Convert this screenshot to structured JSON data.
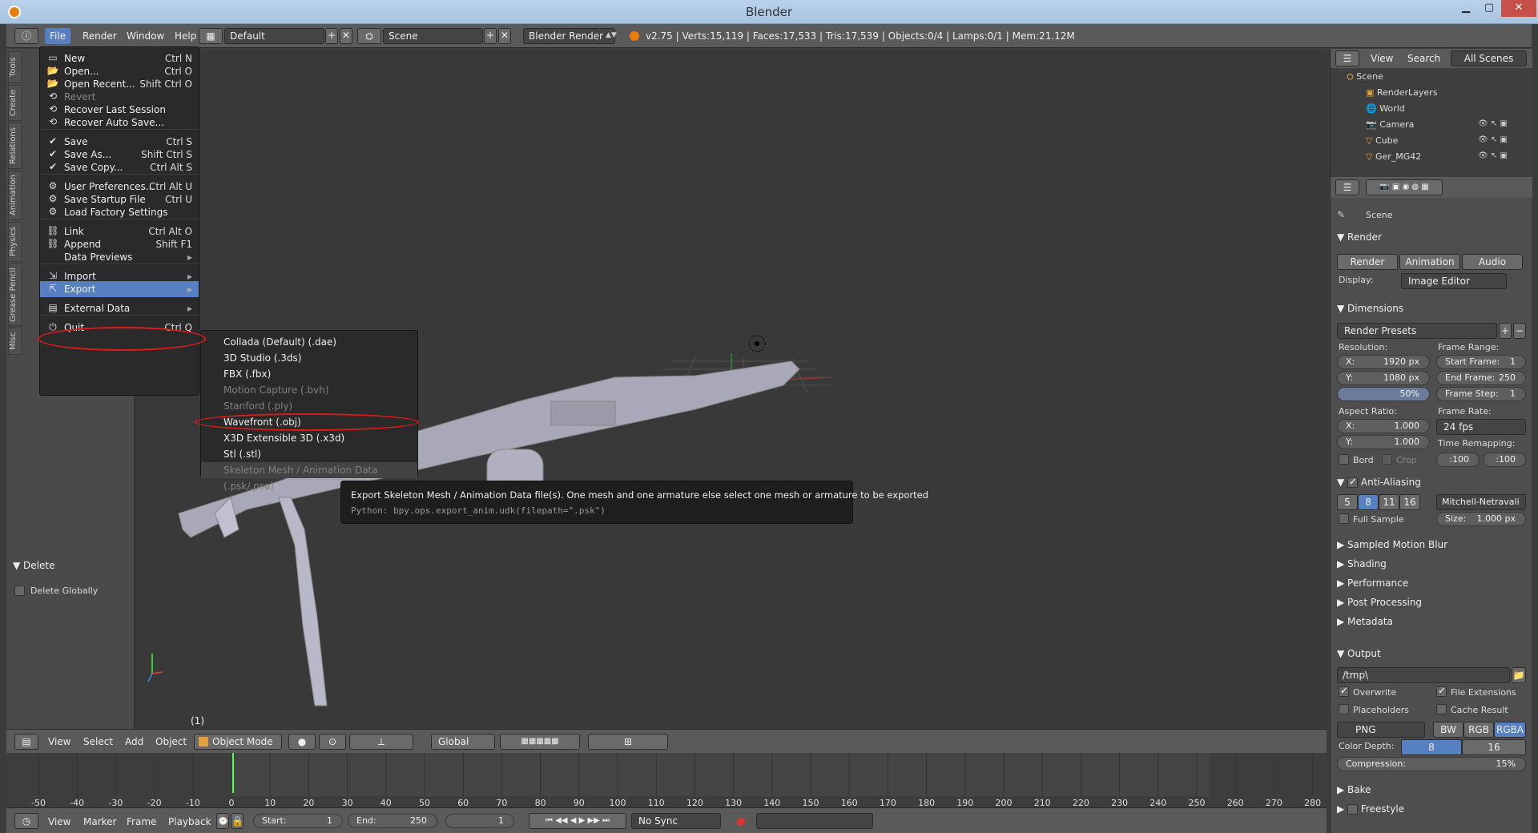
{
  "window": {
    "title": "Blender"
  },
  "topbar": {
    "menus": [
      "File",
      "Render",
      "Window",
      "Help"
    ],
    "layout": "Default",
    "scene": "Scene",
    "engine": "Blender Render",
    "stats": "v2.75 | Verts:15,119 | Faces:17,533 | Tris:17,539 | Objects:0/4 | Lamps:0/1 | Mem:21.12M"
  },
  "toolshelf": {
    "tabs": [
      "Tools",
      "Create",
      "Relations",
      "Animation",
      "Physics",
      "Grease Pencil",
      "Misc"
    ],
    "delete_panel": "Delete",
    "delete_globally": "Delete Globally"
  },
  "file_menu": [
    {
      "label": "New",
      "shortcut": "Ctrl N",
      "icon": "new-file-icon"
    },
    {
      "label": "Open...",
      "shortcut": "Ctrl O",
      "icon": "open-folder-icon"
    },
    {
      "label": "Open Recent...",
      "shortcut": "Shift Ctrl O",
      "icon": "open-recent-icon"
    },
    {
      "label": "Revert",
      "shortcut": "",
      "icon": "revert-icon",
      "disabled": true
    },
    {
      "label": "Recover Last Session",
      "shortcut": "",
      "icon": "recover-icon"
    },
    {
      "label": "Recover Auto Save...",
      "shortcut": "",
      "icon": "recover-auto-icon"
    },
    {
      "label": "Save",
      "shortcut": "Ctrl S",
      "icon": "save-icon"
    },
    {
      "label": "Save As...",
      "shortcut": "Shift Ctrl S",
      "icon": "save-as-icon"
    },
    {
      "label": "Save Copy...",
      "shortcut": "Ctrl Alt S",
      "icon": "save-copy-icon"
    },
    {
      "label": "User Preferences...",
      "shortcut": "Ctrl Alt U",
      "icon": "preferences-icon"
    },
    {
      "label": "Save Startup File",
      "shortcut": "Ctrl U",
      "icon": "startup-icon"
    },
    {
      "label": "Load Factory Settings",
      "shortcut": "",
      "icon": "factory-icon"
    },
    {
      "label": "Link",
      "shortcut": "Ctrl Alt O",
      "icon": "link-icon"
    },
    {
      "label": "Append",
      "shortcut": "Shift F1",
      "icon": "append-icon"
    },
    {
      "label": "Data Previews",
      "shortcut": "",
      "icon": "",
      "submenu": true
    },
    {
      "label": "Import",
      "shortcut": "",
      "icon": "import-icon",
      "submenu": true
    },
    {
      "label": "Export",
      "shortcut": "",
      "icon": "export-icon",
      "submenu": true,
      "highlighted": true
    },
    {
      "label": "External Data",
      "shortcut": "",
      "icon": "external-data-icon",
      "submenu": true
    },
    {
      "label": "Quit",
      "shortcut": "Ctrl Q",
      "icon": "quit-icon"
    }
  ],
  "export_menu": [
    {
      "label": "Collada (Default) (.dae)"
    },
    {
      "label": "3D Studio (.3ds)"
    },
    {
      "label": "FBX (.fbx)"
    },
    {
      "label": "Motion Capture (.bvh)",
      "disabled": true
    },
    {
      "label": "Stanford (.ply)",
      "disabled": true
    },
    {
      "label": "Wavefront (.obj)"
    },
    {
      "label": "X3D Extensible 3D (.x3d)"
    },
    {
      "label": "Stl (.stl)"
    },
    {
      "label": "Skeleton Mesh / Animation Data (.psk/.psa)",
      "disabled": true,
      "highlighted": true
    }
  ],
  "tooltip": {
    "text": "Export Skeleton Mesh / Animation Data file(s). One mesh and one armature else select one mesh or armature to be exported",
    "python": "Python: bpy.ops.export_anim.udk(filepath=\".psk\")"
  },
  "viewport": {
    "frame_label": "(1)"
  },
  "header3d": {
    "menus": [
      "View",
      "Select",
      "Add",
      "Object"
    ],
    "mode": "Object Mode",
    "orientation": "Global"
  },
  "timeline": {
    "ticks": [
      "-50",
      "-40",
      "-30",
      "-20",
      "-10",
      "0",
      "10",
      "20",
      "30",
      "40",
      "50",
      "60",
      "70",
      "80",
      "90",
      "100",
      "110",
      "120",
      "130",
      "140",
      "150",
      "160",
      "170",
      "180",
      "190",
      "200",
      "210",
      "220",
      "230",
      "240",
      "250",
      "260",
      "270",
      "280"
    ],
    "menus": [
      "View",
      "Marker",
      "Frame",
      "Playback"
    ],
    "start_label": "Start:",
    "start": "1",
    "end_label": "End:",
    "end": "250",
    "current": "1",
    "sync": "No Sync"
  },
  "outliner": {
    "menus": [
      "View",
      "Search"
    ],
    "filter": "All Scenes",
    "items": [
      "Scene",
      "RenderLayers",
      "World",
      "Camera",
      "Cube",
      "Ger_MG42"
    ]
  },
  "props": {
    "breadcrumb": "Scene",
    "render_section": "Render",
    "render_btns": [
      "Render",
      "Animation",
      "Audio"
    ],
    "display_label": "Display:",
    "display_value": "Image Editor",
    "dimensions": "Dimensions",
    "presets": "Render Presets",
    "resolution_label": "Resolution:",
    "res_x": "1920 px",
    "res_y": "1080 px",
    "res_pct": "50%",
    "frame_range_label": "Frame Range:",
    "start_frame": "1",
    "end_frame": "250",
    "frame_step": "1",
    "start_frame_label": "Start Frame:",
    "end_frame_label": "End Frame:",
    "frame_step_label": "Frame Step:",
    "aspect_label": "Aspect Ratio:",
    "aspect_x": "1.000",
    "aspect_y": "1.000",
    "frame_rate_label": "Frame Rate:",
    "frame_rate": "24 fps",
    "time_remap_label": "Time Remapping:",
    "remap_old": ":100",
    "remap_new": ":100",
    "bord": "Bord",
    "crop": "Crop",
    "aa": "Anti-Aliasing",
    "aa_samples": [
      "5",
      "8",
      "11",
      "16"
    ],
    "aa_filter": "Mitchell-Netravali",
    "full_sample": "Full Sample",
    "aa_size_label": "Size:",
    "aa_size": "1.000 px",
    "sections": [
      "Sampled Motion Blur",
      "Shading",
      "Performance",
      "Post Processing",
      "Metadata"
    ],
    "output": "Output",
    "output_path": "/tmp\\",
    "overwrite": "Overwrite",
    "file_ext": "File Extensions",
    "placeholders": "Placeholders",
    "cache_result": "Cache Result",
    "format": "PNG",
    "color_modes": [
      "BW",
      "RGB",
      "RGBA"
    ],
    "color_depth_label": "Color Depth:",
    "depths": [
      "8",
      "16"
    ],
    "compression_label": "Compression:",
    "compression": "15%",
    "bake": "Bake",
    "freestyle": "Freestyle"
  }
}
